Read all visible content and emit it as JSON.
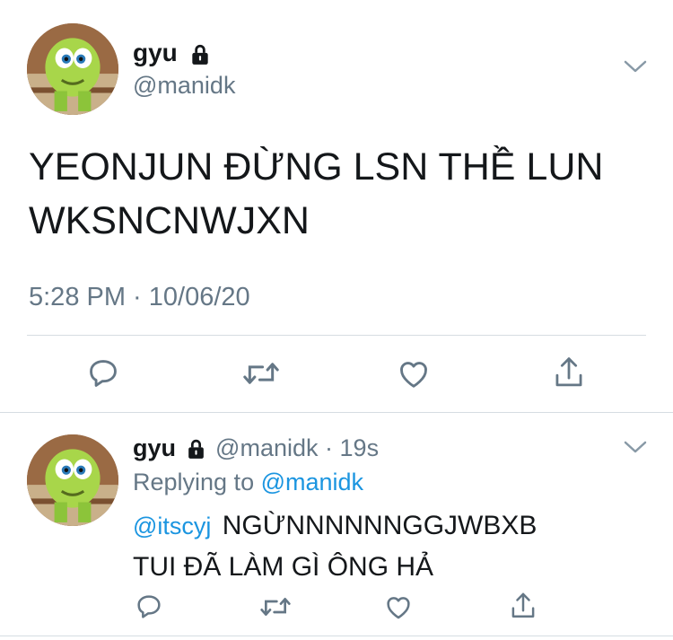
{
  "main_tweet": {
    "display_name": "gyu",
    "handle": "@manidk",
    "text_line1": "YEONJUN ĐỪNG LSN THỀ LUN",
    "text_line2": "WKSNCNWJXN",
    "timestamp": "5:28 PM · 10/06/20"
  },
  "reply_tweet": {
    "display_name": "gyu",
    "handle": "@manidk",
    "separator": "·",
    "age": "19s",
    "replying_prefix": "Replying to",
    "replying_to": "@manidk",
    "mention": "@itscyj",
    "text_line1": "NGỪNNNNNNGGJWBXB",
    "text_line2": "TUI ĐÃ LÀM GÌ ÔNG HẢ"
  },
  "icons": [
    "lock-icon",
    "chevron-down-icon",
    "reply-icon",
    "retweet-icon",
    "like-icon",
    "share-icon"
  ],
  "colors": {
    "text": "#14171a",
    "secondary": "#657786",
    "link": "#1b95e0",
    "divider": "#d6dde2"
  }
}
